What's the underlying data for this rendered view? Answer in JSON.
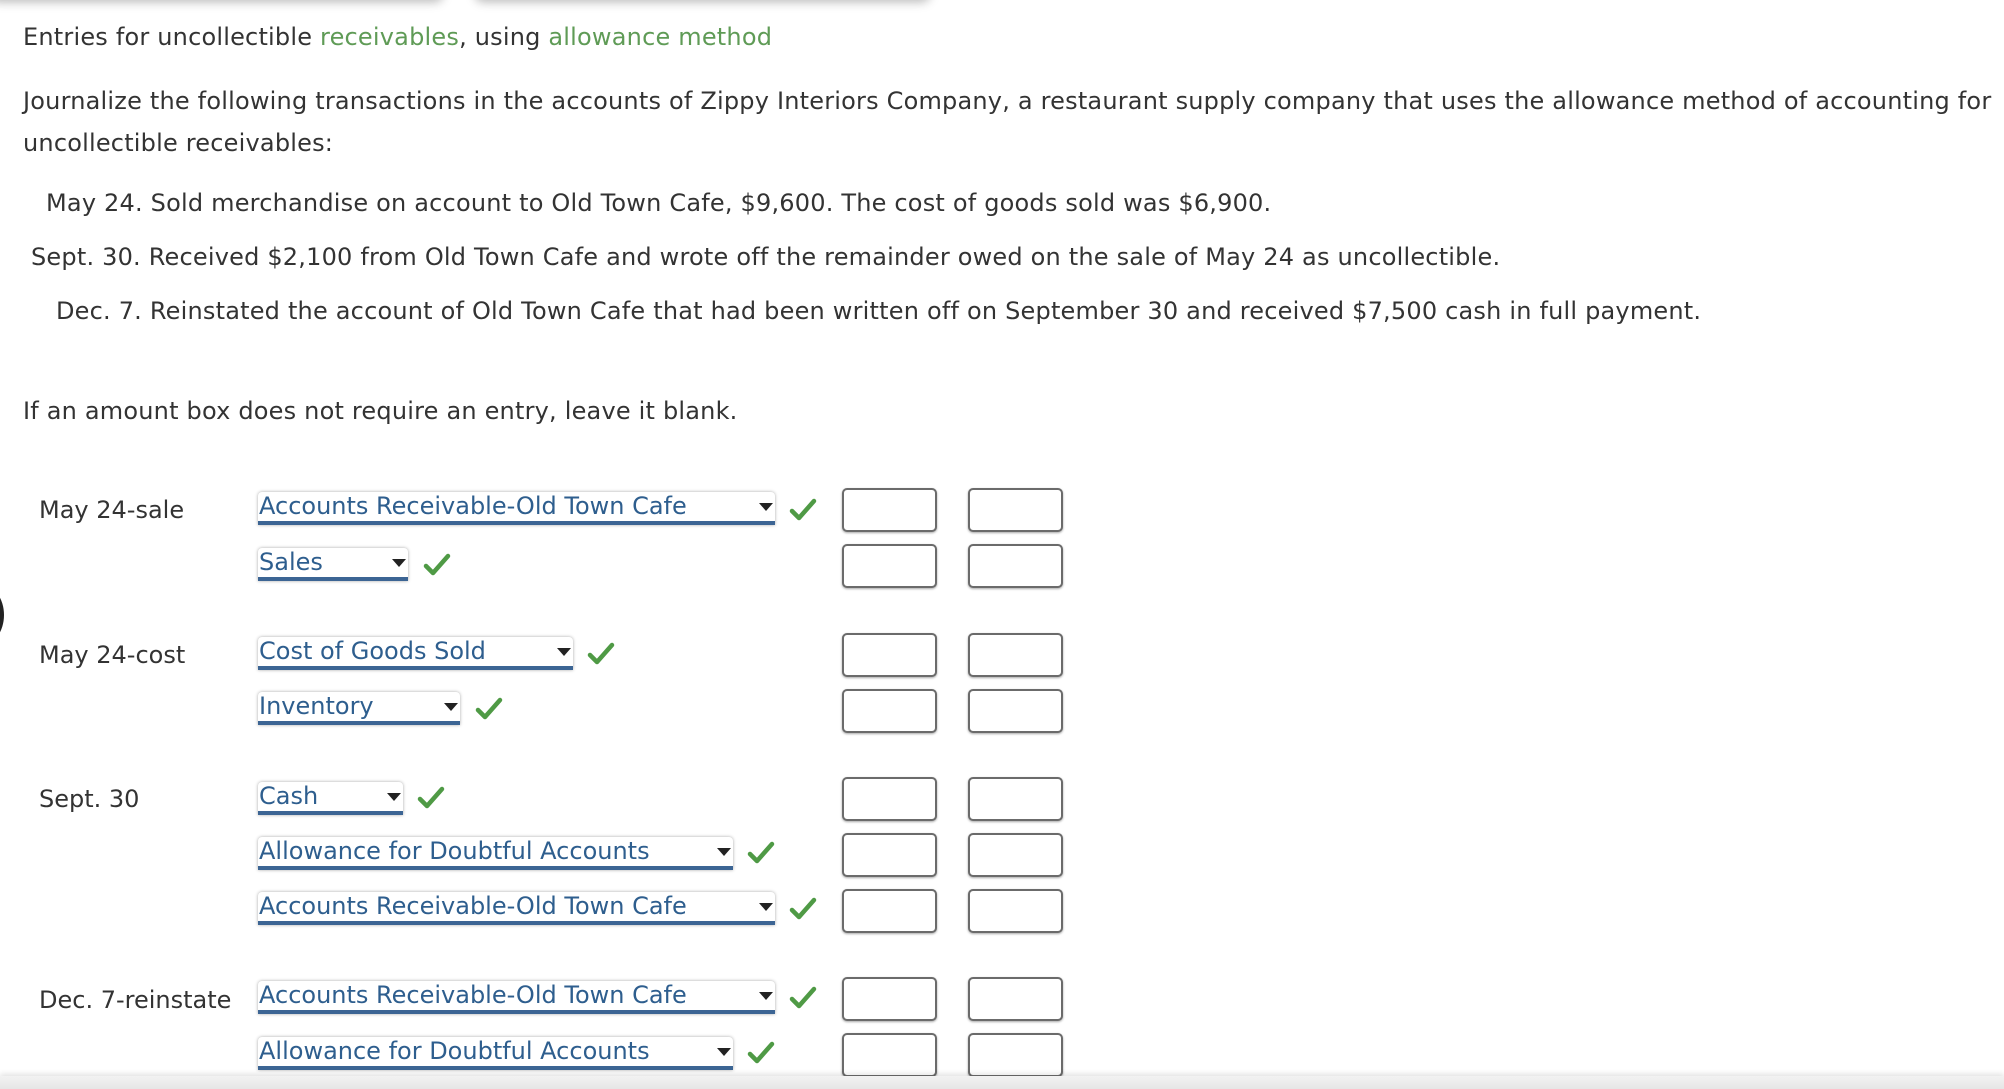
{
  "title": {
    "prefix": "Entries for uncollectible ",
    "link1": "receivables",
    "middle": ", using ",
    "link2": "allowance method"
  },
  "instructions": {
    "line1": "Journalize the following transactions in the accounts of Zippy Interiors Company, a restaurant supply company that uses the allowance method of accounting for",
    "line2": "uncollectible receivables:"
  },
  "transactions": [
    {
      "date": "May 24.",
      "text": "Sold merchandise on account to Old Town Cafe, $9,600. The cost of goods sold was $6,900."
    },
    {
      "date": "Sept. 30.",
      "text": "Received $2,100 from Old Town Cafe and wrote off the remainder owed on the sale of May 24 as uncollectible."
    },
    {
      "date": "Dec. 7.",
      "text": "Reinstated the account of Old Town Cafe that had been written off on September 30 and received $7,500 cash in full payment."
    }
  ],
  "note": "If an amount box does not require an entry, leave it blank.",
  "colors": {
    "link_green": "#5f9b56",
    "select_text": "#2e5e8e",
    "select_underline": "#3c6594",
    "check_green": "#4f9a45"
  },
  "journal": [
    {
      "label": "May 24-sale",
      "lines": [
        {
          "account": "Accounts Receivable-Old Town Cafe",
          "status": "correct",
          "debit": "",
          "credit": ""
        },
        {
          "account": "Sales",
          "status": "correct",
          "debit": "",
          "credit": ""
        }
      ]
    },
    {
      "label": "May 24-cost",
      "lines": [
        {
          "account": "Cost of Goods Sold",
          "status": "correct",
          "debit": "",
          "credit": ""
        },
        {
          "account": "Inventory",
          "status": "correct",
          "debit": "",
          "credit": ""
        }
      ]
    },
    {
      "label": "Sept. 30",
      "lines": [
        {
          "account": "Cash",
          "status": "correct",
          "debit": "",
          "credit": ""
        },
        {
          "account": "Allowance for Doubtful Accounts",
          "status": "correct",
          "debit": "",
          "credit": ""
        },
        {
          "account": "Accounts Receivable-Old Town Cafe",
          "status": "correct",
          "debit": "",
          "credit": ""
        }
      ]
    },
    {
      "label": "Dec. 7-reinstate",
      "lines": [
        {
          "account": "Accounts Receivable-Old Town Cafe",
          "status": "correct",
          "debit": "",
          "credit": ""
        },
        {
          "account": "Allowance for Doubtful Accounts",
          "status": "correct",
          "debit": "",
          "credit": ""
        }
      ]
    }
  ]
}
